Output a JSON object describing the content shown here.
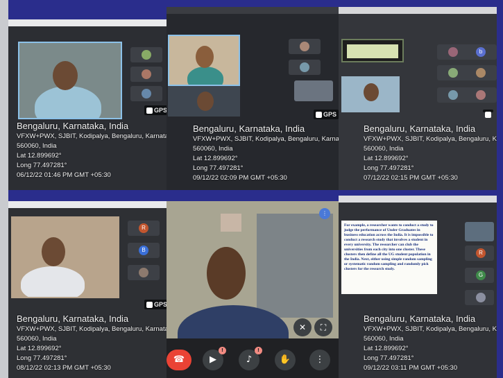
{
  "tiles": [
    {
      "city": "Bengaluru, Karnataka, India",
      "address": "VFXW+PWX, SJBIT, Kodipalya, Bengaluru, Karnataka",
      "postal": "560060, India",
      "lat": "Lat 12.899692°",
      "long": "Long 77.497281°",
      "datetime": "06/12/22 01:46 PM GMT +05:30"
    },
    {
      "city": "Bengaluru, Karnataka, India",
      "address": "VFXW+PWX, SJBIT, Kodipalya, Bengaluru, Karnataka",
      "postal": "560060, India",
      "lat": "Lat 12.899692°",
      "long": "Long 77.497281°",
      "datetime": "09/12/22 02:09 PM GMT +05:30"
    },
    {
      "city": "Bengaluru, Karnataka, India",
      "address": "VFXW+PWX, SJBIT, Kodipalya, Bengaluru, Karnataka",
      "postal": "560060, India",
      "lat": "Lat 12.899692°",
      "long": "Long 77.497281°",
      "datetime": "07/12/22 02:15 PM GMT +05:30"
    },
    {
      "city": "Bengaluru, Karnataka, India",
      "address": "VFXW+PWX, SJBIT, Kodipalya, Bengaluru, Karnataka",
      "postal": "560060, India",
      "lat": "Lat 12.899692°",
      "long": "Long 77.497281°",
      "datetime": "08/12/22 02:13 PM GMT +05:30"
    },
    {
      "city": "Bengaluru, Karnataka, India",
      "address": "VFXW+PWX, SJBIT, Kodipalya, Bengaluru, Karnataka",
      "postal": "560060, India",
      "lat": "Lat 12.899692°",
      "long": "Long 77.497281°",
      "datetime": "09/12/22 03:11 PM GMT +05:30"
    }
  ],
  "gps_label": "GPS",
  "slide_text": "For example, a researcher wants to conduct a study to judge the performance of Under Graduates in business education across the India. It is impossible to conduct a research study that involves a student in every university. The researcher can club the universities from each city into one cluster. These clusters then define all the UG student population in the India. Next, either using simple random sampling or systematic random sampling and randomly pick clusters for the research study.",
  "participants": {
    "tile4": [
      "R",
      "B"
    ],
    "tile5": [
      "R",
      "G"
    ],
    "tile3": [
      "b"
    ]
  },
  "meet_controls": {
    "end_call_icon": "phone-hangup-icon",
    "camera_icon": "camera-off-icon",
    "mic_icon": "mic-off-icon",
    "hand_icon": "raise-hand-icon",
    "more_icon": "more-vert-icon",
    "warning_badge": "!"
  },
  "colors": {
    "background": "#2a2d8c",
    "end_call": "#ea4335",
    "control": "#3c4043"
  }
}
